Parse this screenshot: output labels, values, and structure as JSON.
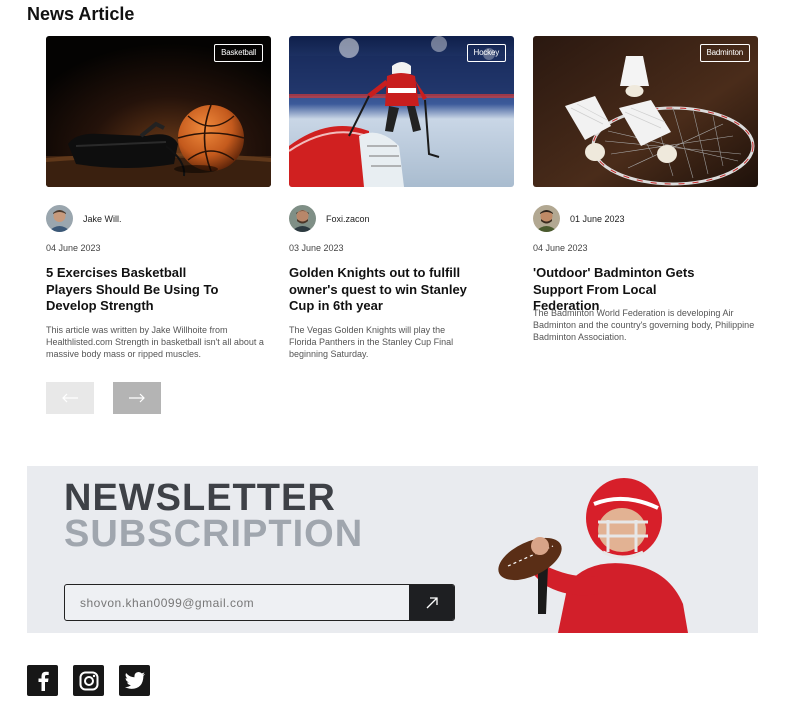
{
  "section_title": "News Article",
  "cards": [
    {
      "tag": "Basketball",
      "author": "Jake Will.",
      "date": "04 June 2023",
      "headline": "5 Exercises Basketball Players Should Be Using To Develop Strength",
      "excerpt": "This article was written by Jake Willhoite from Healthlisted.com Strength in basketball isn't all about a massive body mass or ripped muscles."
    },
    {
      "tag": "Hockey",
      "author": "Foxi.zacon",
      "date": "03 June 2023",
      "headline": "Golden Knights out to fulfill owner's quest to win Stanley Cup in 6th year",
      "excerpt": "The Vegas Golden Knights will play the Florida Panthers in the Stanley Cup Final beginning Saturday."
    },
    {
      "tag": "Badminton",
      "author": "01 June 2023",
      "date": "04 June 2023",
      "headline": "'Outdoor' Badminton Gets Support From Local Federation",
      "excerpt": "The Badminton World Federation is developing Air Badminton and the country's governing body, Philippine Badminton Association."
    }
  ],
  "pagination": {
    "prev_icon": "arrow-left-icon",
    "next_icon": "arrow-right-icon"
  },
  "newsletter": {
    "title_line1": "NEWSLETTER",
    "title_line2": "SUBSCRIPTION",
    "input_value": "shovon.khan0099@gmail.com",
    "submit_icon": "arrow-up-right-icon"
  },
  "socials": [
    "facebook-icon",
    "instagram-icon",
    "twitter-icon"
  ],
  "colors": {
    "dark": "#171717",
    "newsletter_bg": "#e9ebef",
    "prev_button": "#e8e8e8",
    "next_button": "#b4b4b4"
  }
}
